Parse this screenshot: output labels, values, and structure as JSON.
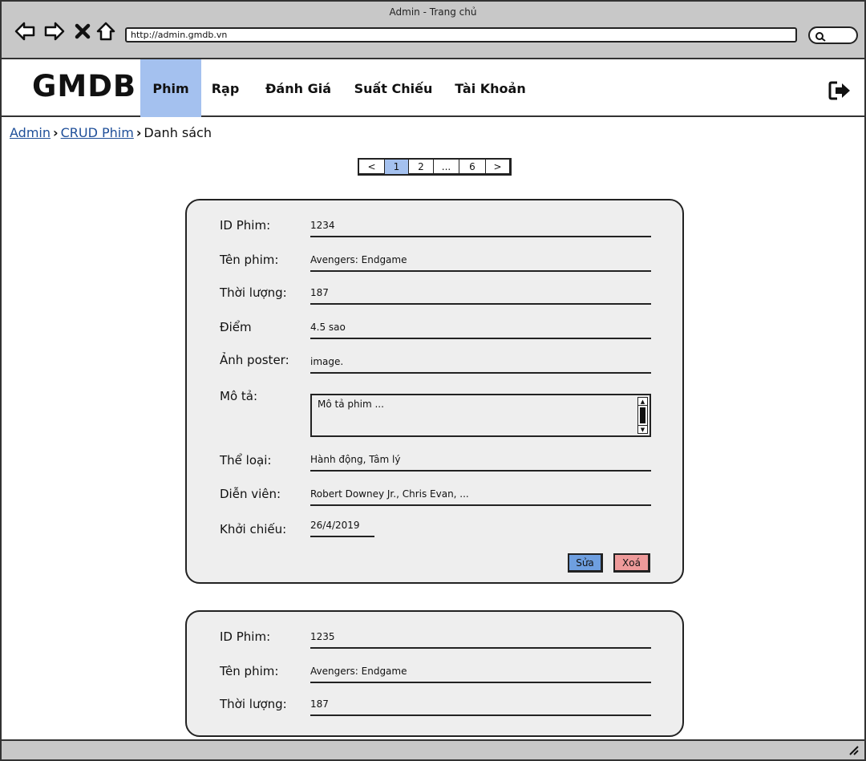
{
  "window": {
    "title": "Admin  - Trang chủ",
    "url": "http://admin.gmdb.vn"
  },
  "nav": {
    "logo": "GMDB",
    "items": [
      {
        "label": "Phim",
        "active": true
      },
      {
        "label": "Rạp",
        "active": false
      },
      {
        "label": "Đánh Giá",
        "active": false
      },
      {
        "label": "Suất Chiếu",
        "active": false
      },
      {
        "label": "Tài Khoản",
        "active": false
      }
    ]
  },
  "breadcrumb": {
    "items": [
      "Admin",
      "CRUD Phim",
      "Danh sách"
    ],
    "separator": "›"
  },
  "pagination": {
    "pages": [
      "<",
      "1",
      "2",
      "...",
      "6",
      ">"
    ],
    "current": "1"
  },
  "cards": [
    {
      "fields": {
        "id": {
          "label": "ID Phim:",
          "value": "1234"
        },
        "name": {
          "label": "Tên phim:",
          "value": "Avengers: Endgame"
        },
        "duration": {
          "label": "Thời lượng:",
          "value": "187"
        },
        "score": {
          "label": "Điểm",
          "value": "4.5 sao"
        },
        "poster": {
          "label": "Ảnh poster:",
          "value": "image."
        },
        "description": {
          "label": "Mô tả:",
          "value": "Mô tả phim ..."
        },
        "genre": {
          "label": "Thể loại:",
          "value": "Hành động, Tâm lý"
        },
        "cast": {
          "label": "Diễn viên:",
          "value": "Robert Downey Jr., Chris Evan, ..."
        },
        "release": {
          "label": "Khởi chiếu:",
          "value": "26/4/2019"
        }
      },
      "actions": {
        "edit": "Sửa",
        "delete": "Xoá"
      }
    },
    {
      "fields": {
        "id": {
          "label": "ID Phim:",
          "value": "1235"
        },
        "name": {
          "label": "Tên phim:",
          "value": "Avengers: Endgame"
        },
        "duration": {
          "label": "Thời lượng:",
          "value": "187"
        }
      }
    }
  ],
  "colors": {
    "active_nav": "#a4c1ef",
    "edit_button": "#6e9fe0",
    "delete_button": "#ee9a9a",
    "chrome": "#c8c8c8",
    "card_bg": "#eeeeee",
    "link": "#1f4f99"
  },
  "icons": {
    "back": "back-arrow-icon",
    "forward": "forward-arrow-icon",
    "stop": "close-icon",
    "home": "home-icon",
    "search": "search-icon",
    "logout": "logout-icon",
    "resize": "resize-grip-icon"
  }
}
